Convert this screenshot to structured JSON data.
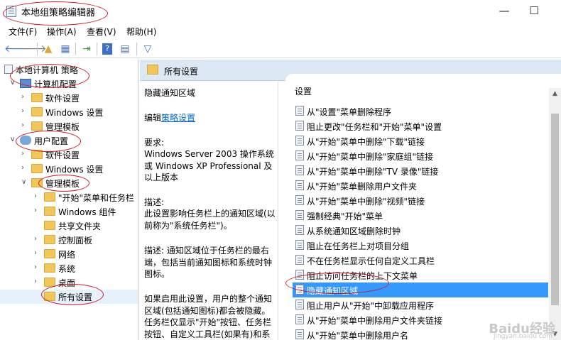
{
  "window": {
    "title": "本地组策略编辑器",
    "minimize": "—",
    "maximize": "☐"
  },
  "menu": [
    "文件(F)",
    "操作(A)",
    "查看(V)",
    "帮助(H)"
  ],
  "tree": [
    {
      "label": "本地计算机 策略",
      "indent": 0,
      "expand": "",
      "icon": "policy-icon"
    },
    {
      "label": "计算机配置",
      "indent": 1,
      "expand": "∨",
      "icon": "computer-icon"
    },
    {
      "label": "软件设置",
      "indent": 2,
      "expand": "›",
      "icon": "folder-icon"
    },
    {
      "label": "Windows 设置",
      "indent": 2,
      "expand": "›",
      "icon": "folder-icon"
    },
    {
      "label": "管理模板",
      "indent": 2,
      "expand": "›",
      "icon": "folder-icon"
    },
    {
      "label": "用户配置",
      "indent": 1,
      "expand": "∨",
      "icon": "user-icon"
    },
    {
      "label": "软件设置",
      "indent": 2,
      "expand": "›",
      "icon": "folder-icon"
    },
    {
      "label": "Windows 设置",
      "indent": 2,
      "expand": "›",
      "icon": "folder-icon"
    },
    {
      "label": "管理模板",
      "indent": 2,
      "expand": "∨",
      "icon": "folder-icon"
    },
    {
      "label": "\"开始\"菜单和任务栏",
      "indent": 3,
      "expand": "›",
      "icon": "folder-icon"
    },
    {
      "label": "Windows 组件",
      "indent": 3,
      "expand": "›",
      "icon": "folder-icon"
    },
    {
      "label": "共享文件夹",
      "indent": 3,
      "expand": "",
      "icon": "folder-icon"
    },
    {
      "label": "控制面板",
      "indent": 3,
      "expand": "›",
      "icon": "folder-icon"
    },
    {
      "label": "网络",
      "indent": 3,
      "expand": "›",
      "icon": "folder-icon"
    },
    {
      "label": "系统",
      "indent": 3,
      "expand": "›",
      "icon": "folder-icon"
    },
    {
      "label": "桌面",
      "indent": 3,
      "expand": "›",
      "icon": "folder-icon"
    },
    {
      "label": "所有设置",
      "indent": 3,
      "expand": "",
      "icon": "settings-icon"
    }
  ],
  "panel": {
    "header": "所有设置",
    "list_header": "设置"
  },
  "description": {
    "title": "隐藏通知区域",
    "edit_prefix": "编辑",
    "edit_link": "策略设置",
    "req_label": "要求:",
    "req_1": "Windows Server 2003 操作系统",
    "req_2": "或 Windows XP Professional 及",
    "req_3": "以上版本",
    "desc_label": "描述:",
    "desc_1": "此设置影响任务栏上的通知区域(以",
    "desc_2": "前称为\"系统任务栏\")。",
    "desc_3": "描述: 通知区域位于任务栏的最右",
    "desc_4": "端，包括当前通知图标和系统时钟",
    "desc_5": "图标。",
    "desc_6": "如果启用此设置，用户的整个通知",
    "desc_7": "区域(包括通知图标)都会被隐藏。",
    "desc_8": "任务栏仅显示\"开始\"按钮、任务栏",
    "desc_9": "按钮、自定义工具栏(如果有)和系"
  },
  "settings": [
    "从\"设置\"菜单删除程序",
    "阻止更改\"任务栏和\"开始\"菜单\"设置",
    "从\"开始\"菜单中删除\"下载\"链接",
    "从\"开始\"菜单中删除\"家庭组\"链接",
    "从\"开始\"菜单中删除\"TV 录像\"链接",
    "从\"开始\"菜单删除用户文件夹",
    "从\"开始\"菜单中删除\"视频\"链接",
    "强制经典\"开始\"菜单",
    "从系统通知区域删除时钟",
    "阻止在任务栏上对项目分组",
    "不在任务栏显示任何自定义工具栏",
    "阻止访问任务栏的上下文菜单",
    "隐藏通知区域",
    "阻止用户从\"开始\"中卸载应用程序",
    "从\"开始\"菜单中删除用户文件夹链接",
    "从\"开始\"菜单中删除用户名"
  ],
  "selected_setting_index": 12,
  "watermark": "Baidu经验",
  "watermark_sub": "jingyan.baidu.com"
}
